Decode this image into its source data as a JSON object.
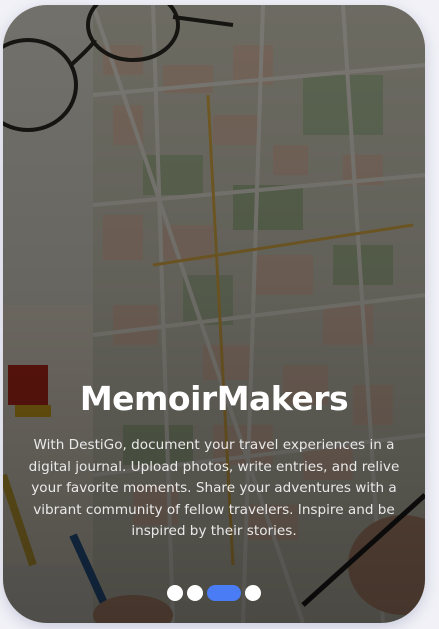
{
  "onboarding": {
    "title": "MemoirMakers",
    "description": "With DestiGo, document your travel experiences in a digital journal. Upload photos, write entries, and relive your favorite moments. Share your adventures with a vibrant community of fellow travelers. Inspire and be inspired by their stories.",
    "background_image": "map-with-glasses-photo",
    "pagination": {
      "total": 4,
      "active_index": 2,
      "active_color": "#4a7cf5",
      "inactive_color": "#ffffff"
    }
  }
}
